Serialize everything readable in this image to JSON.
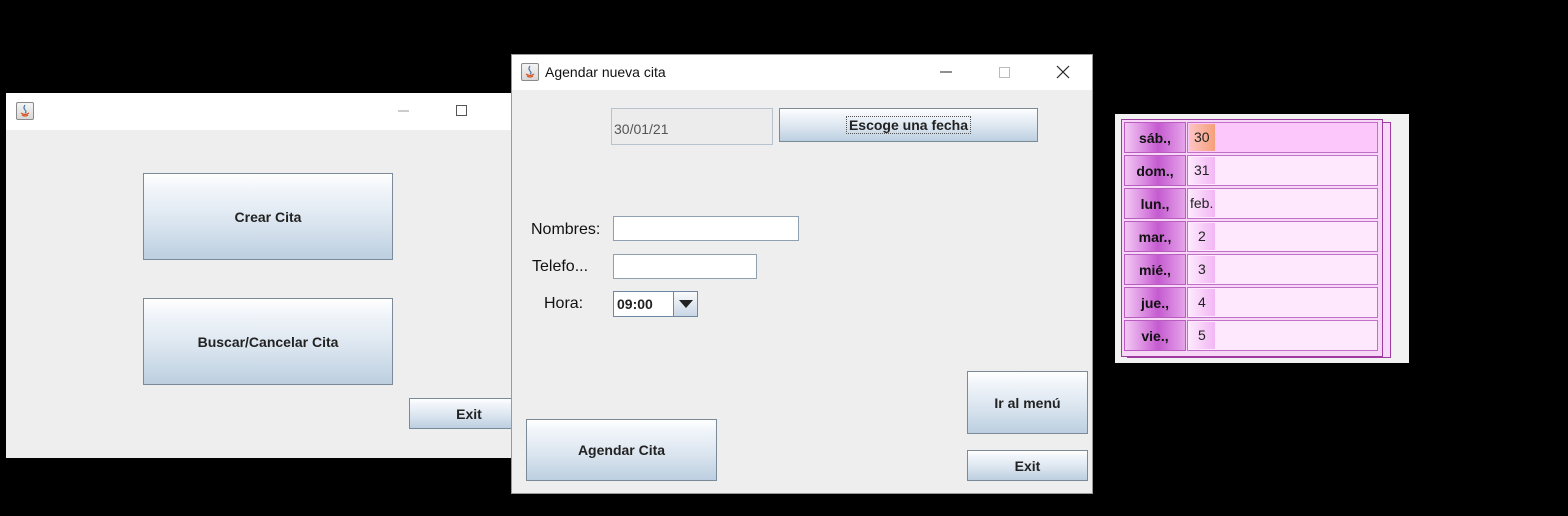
{
  "main_window": {
    "title": "",
    "buttons": {
      "crear": "Crear Cita",
      "buscar": "Buscar/Cancelar Cita",
      "exit": "Exit"
    }
  },
  "dialog": {
    "title": "Agendar nueva cita",
    "date_value": "30/01/21",
    "choose_date_button": "Escoge una fecha",
    "labels": {
      "nombres": "Nombres:",
      "telefono": "Telefo...",
      "hora": "Hora:"
    },
    "fields": {
      "nombres": "",
      "telefono": ""
    },
    "hora_selected": "09:00",
    "buttons": {
      "agendar": "Agendar Cita",
      "menu": "Ir al menú",
      "exit": "Exit"
    }
  },
  "calendar": {
    "rows": [
      {
        "day": "sáb.,",
        "value": "30"
      },
      {
        "day": "dom.,",
        "value": "31"
      },
      {
        "day": "lun.,",
        "value": "feb."
      },
      {
        "day": "mar.,",
        "value": "2"
      },
      {
        "day": "mié.,",
        "value": "3"
      },
      {
        "day": "jue.,",
        "value": "4"
      },
      {
        "day": "vie.,",
        "value": "5"
      }
    ]
  },
  "colors": {
    "button_gradient_top": "#ffffff",
    "button_gradient_bottom": "#bccfe0",
    "calendar_day_bg": "#c45bcf",
    "calendar_value_bg": "#fde8fd",
    "window_bg": "#eeeeee"
  },
  "icons": [
    "java-app-icon",
    "minimize-icon",
    "maximize-icon",
    "close-icon",
    "dropdown-arrow-icon"
  ]
}
